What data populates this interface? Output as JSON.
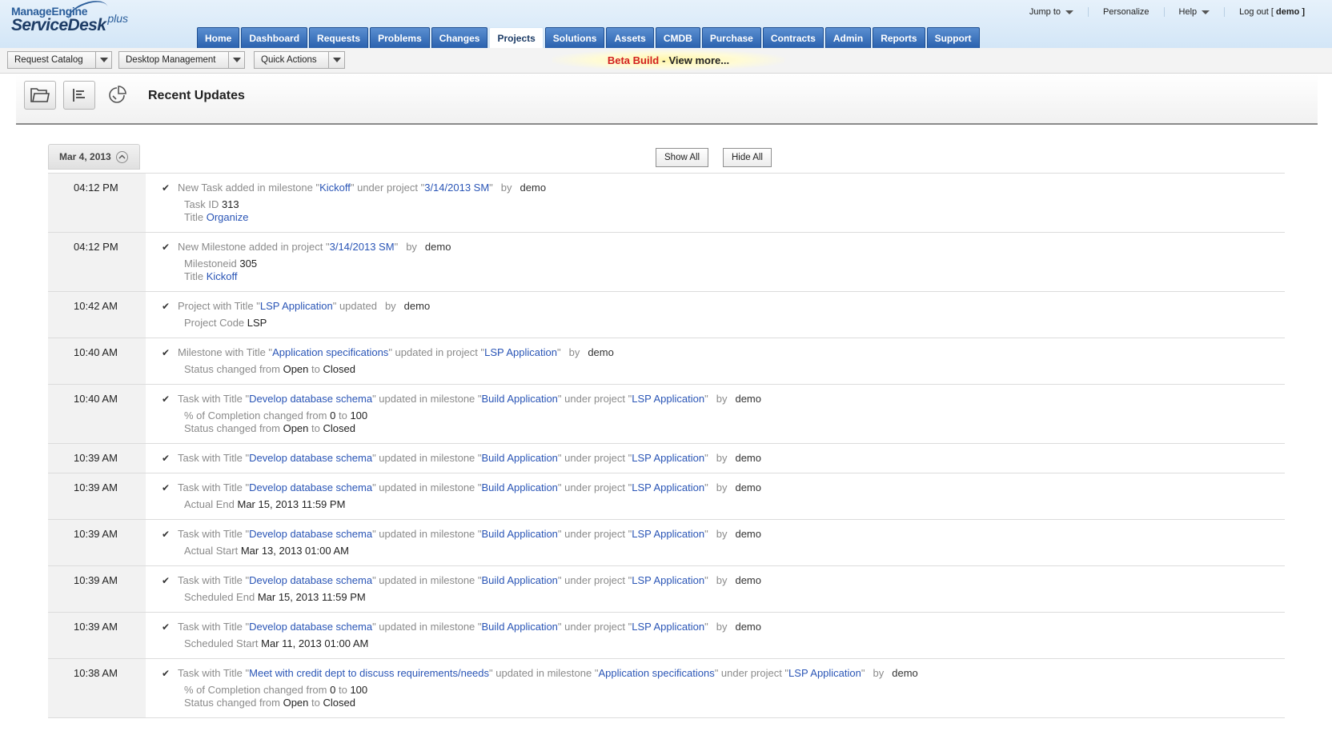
{
  "app": {
    "logo_top": "ManageEngine",
    "logo_name": "ServiceDesk",
    "logo_plus": "plus"
  },
  "toplinks": {
    "jump_to": "Jump to",
    "personalize": "Personalize",
    "help": "Help",
    "logout": "Log out [",
    "user": "demo",
    "logout_close": "]"
  },
  "tabs": [
    "Home",
    "Dashboard",
    "Requests",
    "Problems",
    "Changes",
    "Projects",
    "Solutions",
    "Assets",
    "CMDB",
    "Purchase",
    "Contracts",
    "Admin",
    "Reports",
    "Support"
  ],
  "active_tab": "Projects",
  "subbar": {
    "request_catalog": "Request Catalog",
    "desktop_management": "Desktop Management",
    "quick_actions": "Quick Actions",
    "beta_label": "Beta Build",
    "beta_sep": "-",
    "beta_more": "View more..."
  },
  "page": {
    "title": "Recent Updates",
    "date": "Mar 4, 2013",
    "show_all": "Show All",
    "hide_all": "Hide All"
  },
  "entries": [
    {
      "time": "04:12 PM",
      "line": [
        [
          "t",
          "New Task added in milestone \""
        ],
        [
          "l",
          "Kickoff"
        ],
        [
          "t",
          "\" under project \""
        ],
        [
          "l",
          "3/14/2013 SM"
        ],
        [
          "t",
          "\""
        ]
      ],
      "by": "by",
      "user": "demo",
      "details": [
        {
          "label": "Task ID",
          "value": "313"
        },
        {
          "label": "Title",
          "link": "Organize"
        }
      ]
    },
    {
      "time": "04:12 PM",
      "line": [
        [
          "t",
          "New Milestone added in project \""
        ],
        [
          "l",
          "3/14/2013 SM"
        ],
        [
          "t",
          "\""
        ]
      ],
      "by": "by",
      "user": "demo",
      "details": [
        {
          "label": "Milestoneid",
          "value": "305"
        },
        {
          "label": "Title",
          "link": "Kickoff"
        }
      ]
    },
    {
      "time": "10:42 AM",
      "line": [
        [
          "t",
          "Project with Title \""
        ],
        [
          "l",
          "LSP Application"
        ],
        [
          "t",
          "\" updated"
        ]
      ],
      "by": "by",
      "user": "demo",
      "details": [
        {
          "label": "Project Code",
          "value": "LSP"
        }
      ]
    },
    {
      "time": "10:40 AM",
      "line": [
        [
          "t",
          "Milestone with Title \""
        ],
        [
          "l",
          "Application specifications"
        ],
        [
          "t",
          "\" updated in project \""
        ],
        [
          "l",
          "LSP Application"
        ],
        [
          "t",
          "\""
        ]
      ],
      "by": "by",
      "user": "demo",
      "details": [
        {
          "label": "Status changed from",
          "value": "Open",
          "mid": "to",
          "value2": "Closed"
        }
      ]
    },
    {
      "time": "10:40 AM",
      "line": [
        [
          "t",
          "Task with Title \""
        ],
        [
          "l",
          "Develop database schema"
        ],
        [
          "t",
          "\" updated in milestone \""
        ],
        [
          "l",
          "Build Application"
        ],
        [
          "t",
          "\" under project \""
        ],
        [
          "l",
          "LSP Application"
        ],
        [
          "t",
          "\""
        ]
      ],
      "by": "by",
      "user": "demo",
      "details": [
        {
          "label": "% of Completion changed from",
          "value": "0",
          "mid": "to",
          "value2": "100"
        },
        {
          "label": "Status changed from",
          "value": "Open",
          "mid": "to",
          "value2": "Closed"
        }
      ]
    },
    {
      "time": "10:39 AM",
      "line": [
        [
          "t",
          "Task with Title \""
        ],
        [
          "l",
          "Develop database schema"
        ],
        [
          "t",
          "\" updated in milestone \""
        ],
        [
          "l",
          "Build Application"
        ],
        [
          "t",
          "\" under project \""
        ],
        [
          "l",
          "LSP Application"
        ],
        [
          "t",
          "\""
        ]
      ],
      "by": "by",
      "user": "demo",
      "details": []
    },
    {
      "time": "10:39 AM",
      "line": [
        [
          "t",
          "Task with Title \""
        ],
        [
          "l",
          "Develop database schema"
        ],
        [
          "t",
          "\" updated in milestone \""
        ],
        [
          "l",
          "Build Application"
        ],
        [
          "t",
          "\" under project \""
        ],
        [
          "l",
          "LSP Application"
        ],
        [
          "t",
          "\""
        ]
      ],
      "by": "by",
      "user": "demo",
      "details": [
        {
          "label": "Actual End",
          "value": "Mar 15, 2013 11:59 PM"
        }
      ]
    },
    {
      "time": "10:39 AM",
      "line": [
        [
          "t",
          "Task with Title \""
        ],
        [
          "l",
          "Develop database schema"
        ],
        [
          "t",
          "\" updated in milestone \""
        ],
        [
          "l",
          "Build Application"
        ],
        [
          "t",
          "\" under project \""
        ],
        [
          "l",
          "LSP Application"
        ],
        [
          "t",
          "\""
        ]
      ],
      "by": "by",
      "user": "demo",
      "details": [
        {
          "label": "Actual Start",
          "value": "Mar 13, 2013 01:00 AM"
        }
      ]
    },
    {
      "time": "10:39 AM",
      "line": [
        [
          "t",
          "Task with Title \""
        ],
        [
          "l",
          "Develop database schema"
        ],
        [
          "t",
          "\" updated in milestone \""
        ],
        [
          "l",
          "Build Application"
        ],
        [
          "t",
          "\" under project \""
        ],
        [
          "l",
          "LSP Application"
        ],
        [
          "t",
          "\""
        ]
      ],
      "by": "by",
      "user": "demo",
      "details": [
        {
          "label": "Scheduled End",
          "value": "Mar 15, 2013 11:59 PM"
        }
      ]
    },
    {
      "time": "10:39 AM",
      "line": [
        [
          "t",
          "Task with Title \""
        ],
        [
          "l",
          "Develop database schema"
        ],
        [
          "t",
          "\" updated in milestone \""
        ],
        [
          "l",
          "Build Application"
        ],
        [
          "t",
          "\" under project \""
        ],
        [
          "l",
          "LSP Application"
        ],
        [
          "t",
          "\""
        ]
      ],
      "by": "by",
      "user": "demo",
      "details": [
        {
          "label": "Scheduled Start",
          "value": "Mar 11, 2013 01:00 AM"
        }
      ]
    },
    {
      "time": "10:38 AM",
      "line": [
        [
          "t",
          "Task with Title \""
        ],
        [
          "l",
          "Meet with credit dept to discuss requirements/needs"
        ],
        [
          "t",
          "\" updated in milestone \""
        ],
        [
          "l",
          "Application specifications"
        ],
        [
          "t",
          "\" under project \""
        ],
        [
          "l",
          "LSP Application"
        ],
        [
          "t",
          "\""
        ]
      ],
      "by": "by",
      "user": "demo",
      "details": [
        {
          "label": "% of Completion changed from",
          "value": "0",
          "mid": "to",
          "value2": "100"
        },
        {
          "label": "Status changed from",
          "value": "Open",
          "mid": "to",
          "value2": "Closed"
        }
      ]
    }
  ],
  "icons": {
    "tick": "check-icon",
    "folder": "folder-icon",
    "list": "list-view-icon",
    "chart": "pie-chart-icon"
  }
}
